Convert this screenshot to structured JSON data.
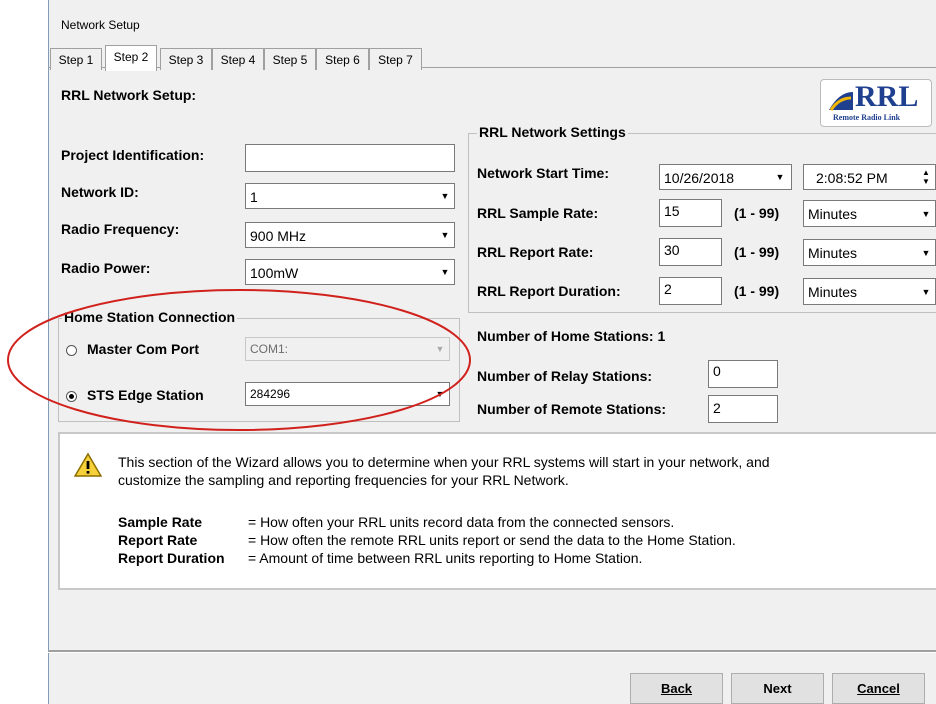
{
  "window": {
    "title": "Network Setup"
  },
  "tabs": [
    "Step 1",
    "Step 2",
    "Step 3",
    "Step 4",
    "Step 5",
    "Step 6",
    "Step 7"
  ],
  "heading": "RRL Network Setup:",
  "logo": {
    "big": "RRL",
    "small": "Remote Radio Link"
  },
  "left": {
    "project_label": "Project Identification:",
    "project_value": "",
    "network_label": "Network ID:",
    "network_value": "1",
    "freq_label": "Radio Frequency:",
    "freq_value": "900 MHz",
    "power_label": "Radio Power:",
    "power_value": "100mW"
  },
  "home_station": {
    "title": "Home Station Connection",
    "master_label": "Master Com Port",
    "master_value": "COM1:",
    "sts_label": "STS Edge Station",
    "sts_value": "284296"
  },
  "settings": {
    "title": "RRL Network Settings",
    "start_label": "Network Start Time:",
    "start_date": "10/26/2018",
    "start_time": "2:08:52 PM",
    "sample_label": "RRL Sample Rate:",
    "sample_value": "15",
    "sample_range": "(1 - 99)",
    "sample_unit": "Minutes",
    "report_label": "RRL Report Rate:",
    "report_value": "30",
    "report_range": "(1 - 99)",
    "report_unit": "Minutes",
    "duration_label": "RRL Report Duration:",
    "duration_value": "2",
    "duration_range": "(1 - 99)",
    "duration_unit": "Minutes"
  },
  "stations": {
    "home_label": "Number of Home Stations:  1",
    "relay_label": "Number of Relay Stations:",
    "relay_value": "0",
    "remote_label": "Number of Remote Stations:",
    "remote_value": "2"
  },
  "info": {
    "line1": "This section of the Wizard allows you to determine when your RRL systems will start in your network, and",
    "line2": "customize the sampling and reporting frequencies for your RRL Network.",
    "defs": [
      {
        "term": "Sample Rate",
        "desc": "= How often your RRL units record data from the connected sensors."
      },
      {
        "term": "Report Rate",
        "desc": "= How often the remote RRL units report or send the data to the Home Station."
      },
      {
        "term": "Report Duration",
        "desc": "= Amount of time between RRL units reporting to Home Station."
      }
    ]
  },
  "buttons": {
    "back": "Back",
    "next": "Next",
    "cancel": "Cancel"
  },
  "colors": {
    "annotation": "#d0211c",
    "logo_blue": "#1f3f8f",
    "logo_yellow": "#f2b705"
  }
}
